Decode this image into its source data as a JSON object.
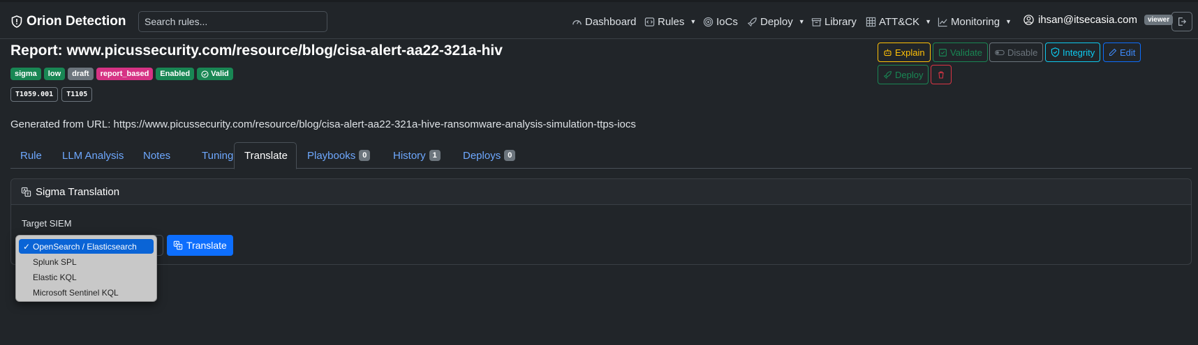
{
  "brand": {
    "name": "Orion Detection"
  },
  "search": {
    "placeholder": "Search rules..."
  },
  "nav": {
    "dashboard": "Dashboard",
    "rules": "Rules",
    "iocs": "IoCs",
    "deploy": "Deploy",
    "library": "Library",
    "attck": "ATT&CK",
    "monitoring": "Monitoring"
  },
  "user": {
    "email": "ihsan@itsecasia.com",
    "role": "viewer"
  },
  "report": {
    "title": "Report: www.picussecurity.com/resource/blog/cisa-alert-aa22-321a-hiv",
    "tags": [
      "sigma",
      "low",
      "draft",
      "report_based",
      "Enabled",
      "Valid"
    ],
    "techniques": [
      "T1059.001",
      "T1105"
    ],
    "generated": "Generated from URL: https://www.picussecurity.com/resource/blog/cisa-alert-aa22-321a-hive-ransomware-analysis-simulation-ttps-iocs"
  },
  "actions": {
    "explain": "Explain",
    "validate": "Validate",
    "disable": "Disable",
    "integrity": "Integrity",
    "edit": "Edit",
    "deploy": "Deploy"
  },
  "tabs": {
    "rule": "Rule",
    "llm": "LLM Analysis",
    "notes": "Notes",
    "tuning": "Tuning",
    "translate": "Translate",
    "playbooks": "Playbooks",
    "playbooks_count": "0",
    "history": "History",
    "history_count": "1",
    "deploys": "Deploys",
    "deploys_count": "0"
  },
  "translation": {
    "header": "Sigma Translation",
    "target_label": "Target SIEM",
    "button": "Translate",
    "options": [
      "OpenSearch / Elasticsearch",
      "Splunk SPL",
      "Elastic KQL",
      "Microsoft Sentinel KQL"
    ],
    "selected": "OpenSearch / Elasticsearch"
  },
  "colors": {
    "background": "#212529",
    "link": "#6ea8fe",
    "warning": "#ffc107",
    "success": "#198754",
    "info": "#0dcaf0",
    "primary": "#0d6efd",
    "danger": "#dc3545",
    "pink": "#d63384"
  }
}
